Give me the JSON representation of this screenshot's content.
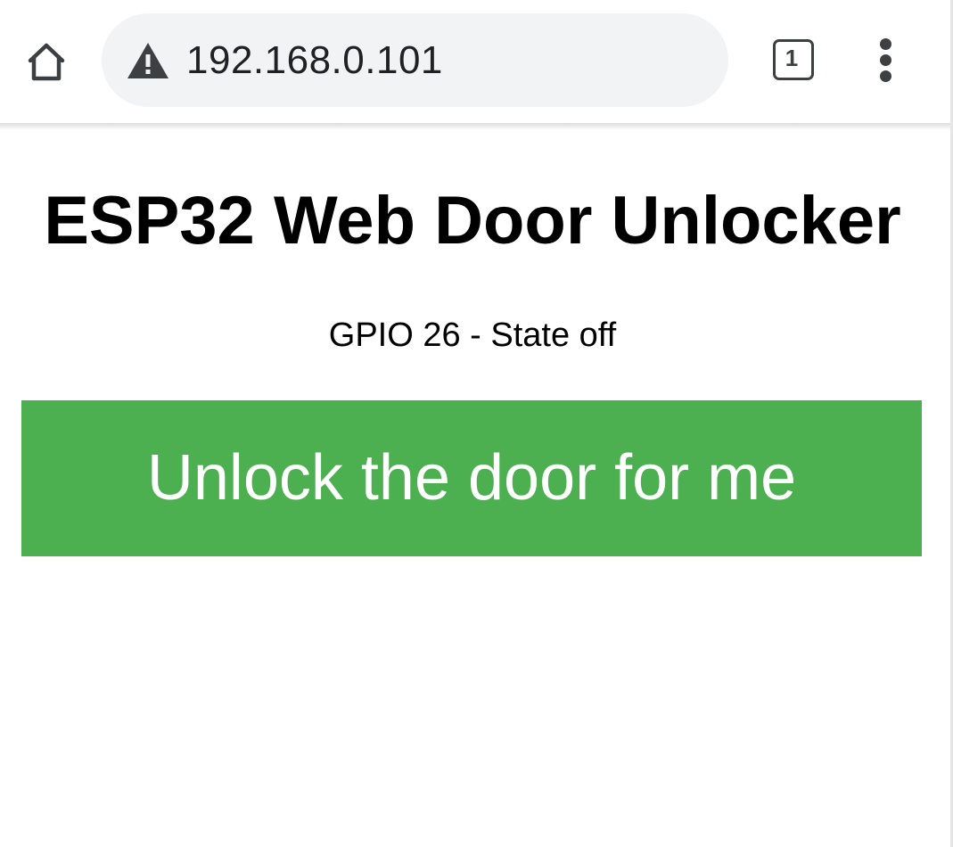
{
  "browser": {
    "url": "192.168.0.101",
    "tab_count": "1",
    "home_icon": "home-icon",
    "security_icon": "warning-triangle-icon",
    "menu_icon": "more-vertical-icon",
    "omnibox_color": "#f1f3f4"
  },
  "page": {
    "heading": "ESP32 Web Door Unlocker",
    "gpio_state": "GPIO 26 - State off",
    "unlock_button_label": "Unlock the door for me",
    "button_color": "#4caf50",
    "button_text_color": "#ffffff"
  }
}
